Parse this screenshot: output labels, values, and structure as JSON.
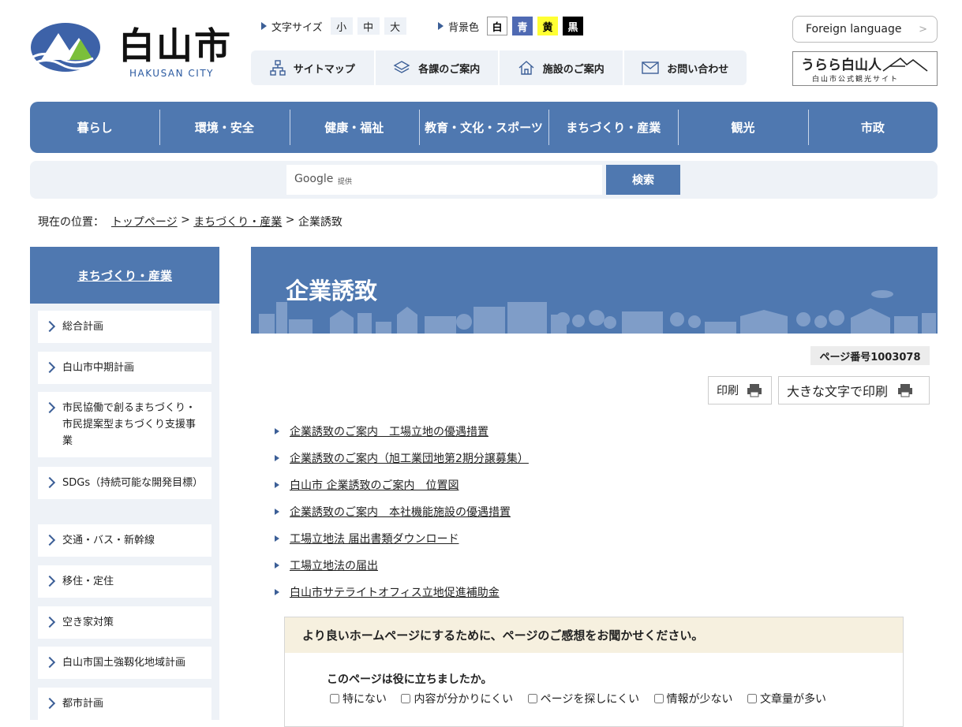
{
  "header": {
    "logo_text": "白山市",
    "logo_en": "HAKUSAN CITY",
    "font_size_label": "文字サイズ",
    "font_sizes": [
      "小",
      "中",
      "大"
    ],
    "bg_color_label": "背景色",
    "bg_colors": [
      {
        "label": "白",
        "bg": "#ffffff",
        "fg": "#000000"
      },
      {
        "label": "青",
        "bg": "#4f6ab3",
        "fg": "#ffffff"
      },
      {
        "label": "黄",
        "bg": "#ffff33",
        "fg": "#000000"
      },
      {
        "label": "黒",
        "bg": "#000000",
        "fg": "#ffffff"
      }
    ],
    "utility_links": [
      "サイトマップ",
      "各課のご案内",
      "施設のご案内",
      "お問い合わせ"
    ],
    "foreign_language": "Foreign language",
    "urara_main": "うらら白山人",
    "urara_sub": "白山市公式観光サイト"
  },
  "global_nav": [
    "暮らし",
    "環境・安全",
    "健康・福祉",
    "教育・文化・スポーツ",
    "まちづくり・産業",
    "観光",
    "市政"
  ],
  "search": {
    "provider": "Google",
    "provider_sub": "提供",
    "button": "検索"
  },
  "breadcrumb": {
    "prefix": "現在の位置：",
    "items": [
      "トップページ",
      "まちづくり・産業",
      "企業誘致"
    ],
    "separator": ">"
  },
  "sidebar": {
    "heading": "まちづくり・産業",
    "items": [
      "総合計画",
      "白山市中期計画",
      "市民協働で創るまちづくり・市民提案型まちづくり支援事業",
      "SDGs（持続可能な開発目標）",
      "交通・バス・新幹線",
      "移住・定住",
      "空き家対策",
      "白山市国土強靱化地域計画",
      "都市計画"
    ]
  },
  "main": {
    "title": "企業誘致",
    "page_number": "ページ番号1003078",
    "print": "印刷",
    "print_large": "大きな文字で印刷",
    "links": [
      "企業誘致のご案内　工場立地の優遇措置",
      "企業誘致のご案内（旭工業団地第2期分譲募集）",
      "白山市 企業誘致のご案内　位置図",
      "企業誘致のご案内　本社機能施設の優遇措置",
      "工場立地法 届出書類ダウンロード",
      "工場立地法の届出",
      "白山市サテライトオフィス立地促進補助金"
    ]
  },
  "feedback": {
    "heading": "より良いホームページにするために、ページのご感想をお聞かせください。",
    "question": "このページは役に立ちましたか。",
    "options": [
      "特にない",
      "内容が分かりにくい",
      "ページを探しにくい",
      "情報が少ない",
      "文章量が多い"
    ]
  },
  "colors": {
    "primary": "#4f78b0",
    "light_bg": "#eef2f7",
    "feedback_bg": "#f6f0df"
  }
}
